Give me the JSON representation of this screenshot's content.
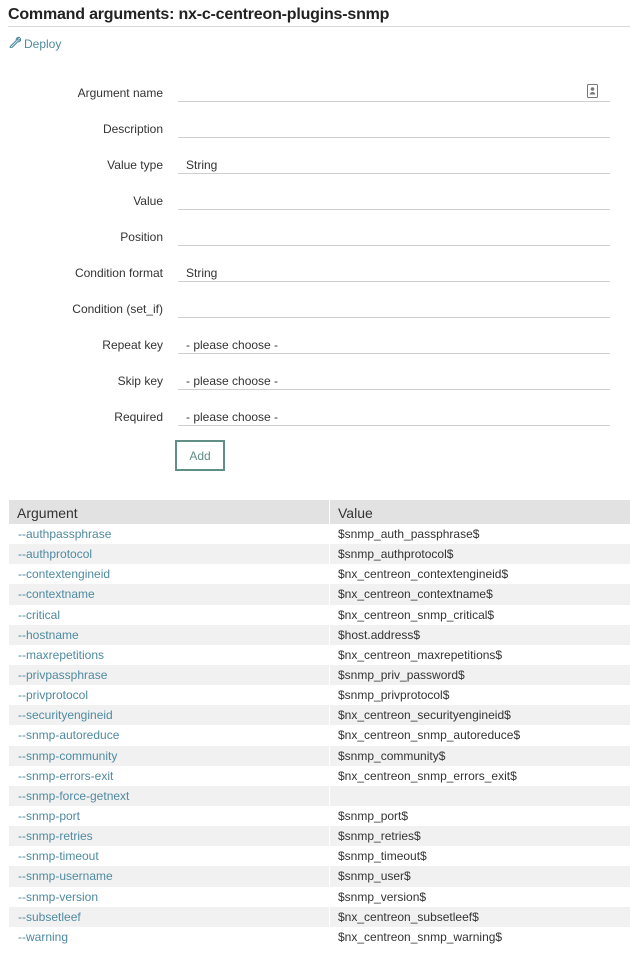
{
  "page": {
    "title": "Command arguments: nx-c-centreon-plugins-snmp",
    "deploy_label": "Deploy"
  },
  "form": {
    "fields": [
      {
        "label": "Argument name",
        "value": ""
      },
      {
        "label": "Description",
        "value": ""
      },
      {
        "label": "Value type",
        "value": "String"
      },
      {
        "label": "Value",
        "value": ""
      },
      {
        "label": "Position",
        "value": ""
      },
      {
        "label": "Condition format",
        "value": "String"
      },
      {
        "label": "Condition (set_if)",
        "value": ""
      },
      {
        "label": "Repeat key",
        "value": "- please choose -"
      },
      {
        "label": "Skip key",
        "value": "- please choose -"
      },
      {
        "label": "Required",
        "value": "- please choose -"
      }
    ],
    "add_label": "Add"
  },
  "table": {
    "headers": {
      "argument": "Argument",
      "value": "Value"
    },
    "rows": [
      {
        "argument": "--authpassphrase",
        "value": "$snmp_auth_passphrase$"
      },
      {
        "argument": "--authprotocol",
        "value": "$snmp_authprotocol$"
      },
      {
        "argument": "--contextengineid",
        "value": "$nx_centreon_contextengineid$"
      },
      {
        "argument": "--contextname",
        "value": "$nx_centreon_contextname$"
      },
      {
        "argument": "--critical",
        "value": "$nx_centreon_snmp_critical$"
      },
      {
        "argument": "--hostname",
        "value": "$host.address$"
      },
      {
        "argument": "--maxrepetitions",
        "value": "$nx_centreon_maxrepetitions$"
      },
      {
        "argument": "--privpassphrase",
        "value": "$snmp_priv_password$"
      },
      {
        "argument": "--privprotocol",
        "value": "$snmp_privprotocol$"
      },
      {
        "argument": "--securityengineid",
        "value": "$nx_centreon_securityengineid$"
      },
      {
        "argument": "--snmp-autoreduce",
        "value": "$nx_centreon_snmp_autoreduce$"
      },
      {
        "argument": "--snmp-community",
        "value": "$snmp_community$"
      },
      {
        "argument": "--snmp-errors-exit",
        "value": "$nx_centreon_snmp_errors_exit$"
      },
      {
        "argument": "--snmp-force-getnext",
        "value": ""
      },
      {
        "argument": "--snmp-port",
        "value": "$snmp_port$"
      },
      {
        "argument": "--snmp-retries",
        "value": "$snmp_retries$"
      },
      {
        "argument": "--snmp-timeout",
        "value": "$snmp_timeout$"
      },
      {
        "argument": "--snmp-username",
        "value": "$snmp_user$"
      },
      {
        "argument": "--snmp-version",
        "value": "$snmp_version$"
      },
      {
        "argument": "--subsetleef",
        "value": "$nx_centreon_subsetleef$"
      },
      {
        "argument": "--warning",
        "value": "$nx_centreon_snmp_warning$"
      }
    ]
  },
  "icons": {
    "deploy": "wrench-icon",
    "argument_name_field": "contact-card-icon"
  },
  "colors": {
    "link": "#4e8aa0",
    "button_border": "#5f8f87",
    "header_bg": "#e2e2e2",
    "row_alt_bg": "#f1f1f1"
  }
}
